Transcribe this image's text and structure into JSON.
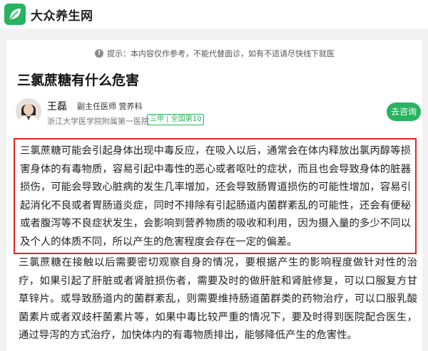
{
  "header": {
    "site_name": "大众养生网"
  },
  "tip": {
    "text": "提示：本内容仅作参考，不能代替面诊，如有不适请尽快线下就医"
  },
  "article": {
    "title": "三氯蔗糖有什么危害",
    "doctor": {
      "name": "王磊",
      "titles": "副主任医师  营养科",
      "hospital": "浙江大学医学院附属第一医院",
      "badge": "三甲 | 全国第10"
    },
    "consult_label": "去咨询",
    "paragraph1": "三氯蔗糖可能会引起身体出现中毒反应，在吸入以后，通常会在体内释放出氯丙醇等损害身体的有毒物质，容易引起中毒性的恶心或者呕吐的症状，而且也会导致身体的脏器损伤，可能会导致心脏病的发生几率增加，还会导致肠胃道损伤的可能性增加，容易引起消化不良或者胃肠道炎症，同时不排除有引起肠道内菌群紊乱的可能性，还会有便秘或者腹泻等不良症状发生，会影响到营养物质的吸收和利用，因为摄入量的多少不同以及个人的体质不同，所以产生的危害程度会存在一定的偏差。",
    "paragraph2": "三氯蔗糖在接触以后需要密切观察自身的情况，要根据产生的影响程度做针对性的治疗，如果引起了肝脏或者肾脏损伤者，需要及时的做肝脏和肾脏修复，可以口服复方甘草锌片。或导致肠道内的菌群紊乱，则需要维持肠道菌群类的药物治疗，可以口服乳酸菌素片或者双歧杆菌素片等，如果中毒比较严重的情况下，要及时得到医院配合医生，通过导泻的方式治疗，加快体内的有毒物质排出，能够降低产生的危害性。"
  }
}
